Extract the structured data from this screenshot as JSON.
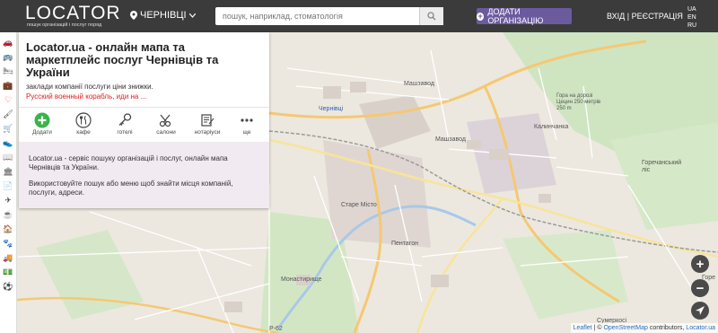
{
  "header": {
    "logo": "LOCATOR",
    "logo_tagline": "пошук організацій і послуг поряд",
    "city": "ЧЕРНІВЦІ",
    "search_placeholder": "пошук, наприклад, стоматологія",
    "add_org": "ДОДАТИ ОРГАНІЗАЦІЮ",
    "login": "ВХІД",
    "separator": "|",
    "register": "РЕЄСТРАЦІЯ",
    "langs": [
      "UA",
      "EN",
      "RU"
    ]
  },
  "panel": {
    "title": "Locator.ua - онлайн мапа та маркетплейс послуг Чернівців та України",
    "subtitle": "заклади компанії послуги ціни знижки.",
    "warning": "Русский военный корабль, иди на ...",
    "categories": [
      {
        "label": "Додати",
        "icon": "plus-icon"
      },
      {
        "label": "кафе",
        "icon": "cutlery-icon"
      },
      {
        "label": "готелі",
        "icon": "key-icon"
      },
      {
        "label": "салони",
        "icon": "scissors-icon"
      },
      {
        "label": "нотаріуси",
        "icon": "document-icon"
      },
      {
        "label": "ще",
        "icon": "more-icon"
      }
    ],
    "desc1": "Locator.ua - сервіс пошуку організацій і послуг, онлайн мапа Чернівців та України.",
    "desc2": "Використовуйте пошук або меню щоб знайти місця компаній, послуги, адреси."
  },
  "map": {
    "labels": {
      "mashzavod": "Машзавод",
      "mashzavod2": "Машзавод",
      "chernivtsi": "Чернівці",
      "kalynivka": "Калинчанка",
      "hora": "Гора на дорозі Цецин 250 метрів 250 m",
      "staremisto": "Старе Місто",
      "pentagon": "Пентагон",
      "monastyryshche": "Монастирище",
      "horecha": "Горечанський ліс",
      "sumerkosi": "Сумеркосі",
      "r62": "Р-62"
    },
    "attribution": {
      "leaflet": "Leaflet",
      "sep": " | © ",
      "osm": "OpenStreetMap",
      "contrib": " contributors, ",
      "locator": "Locator.ua"
    },
    "zoom_in": "+",
    "zoom_out": "−",
    "edge_label": "Горе"
  },
  "colors": {
    "header_bg": "#3b3b3b",
    "accent": "#6c5a9e",
    "warning": "#dd2222",
    "add_icon_bg": "#3bb34a",
    "desc_bg": "#f1eaf1"
  }
}
